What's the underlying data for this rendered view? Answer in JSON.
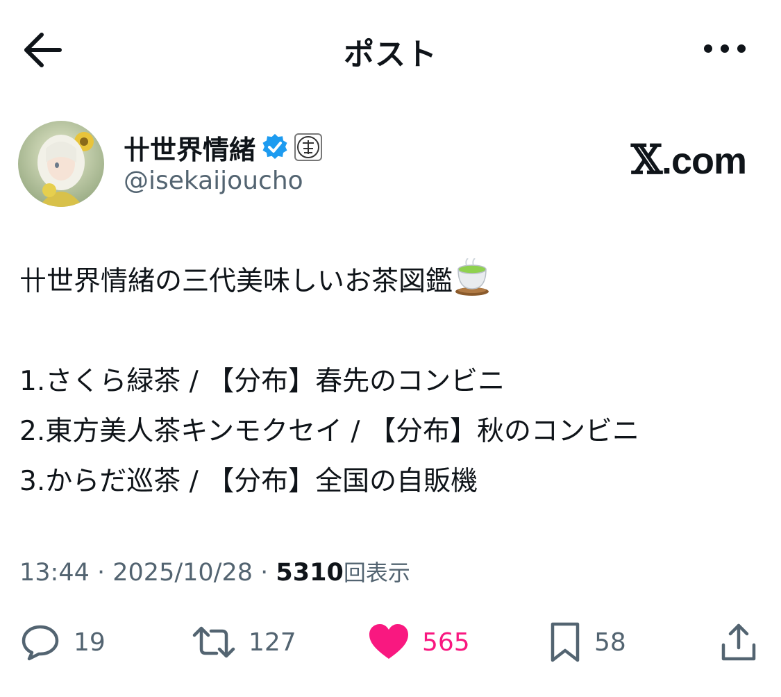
{
  "header": {
    "title": "ポスト"
  },
  "author": {
    "display_name": "卄世界情緒",
    "handle": "@isekaijoucho",
    "verified": true
  },
  "watermark": {
    "x": "𝕏",
    "domain": ".com"
  },
  "post": {
    "lines": [
      "卄世界情緒の三代美味しいお茶図鑑",
      "",
      "1.さくら緑茶 / 【分布】春先のコンビニ",
      "2.東方美人茶キンモクセイ / 【分布】秋のコンビニ",
      "3.からだ巡茶 / 【分布】全国の自販機"
    ]
  },
  "meta": {
    "time": "13:44",
    "sep1": " · ",
    "date": "2025/10/28",
    "sep2": " · ",
    "views_count": "5310",
    "views_label": "回表示"
  },
  "actions": {
    "replies": "19",
    "reposts": "127",
    "likes": "565",
    "bookmarks": "58"
  },
  "colors": {
    "text": "#0f1419",
    "secondary": "#536471",
    "like": "#f91880",
    "verified": "#1d9bf0"
  },
  "icons": {
    "back": "arrow-left-icon",
    "more": "more-dots-icon",
    "verified": "verified-badge-icon",
    "reply": "reply-icon",
    "repost": "repost-icon",
    "like": "heart-icon",
    "bookmark": "bookmark-icon",
    "share": "share-icon",
    "tea": "tea-emoji-icon"
  }
}
